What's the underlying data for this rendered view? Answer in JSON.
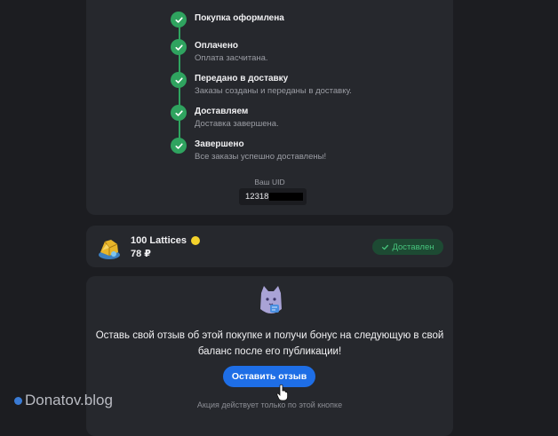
{
  "timeline": {
    "steps": [
      {
        "title": "Покупка оформлена",
        "desc": ""
      },
      {
        "title": "Оплачено",
        "desc": "Оплата засчитана."
      },
      {
        "title": "Передано в доставку",
        "desc": "Заказы созданы и переданы в доставку."
      },
      {
        "title": "Доставляем",
        "desc": "Доставка завершена."
      },
      {
        "title": "Завершено",
        "desc": "Все заказы успешно доставлены!"
      }
    ]
  },
  "uid": {
    "label": "Ваш UID",
    "value_visible": "12318"
  },
  "product": {
    "name": "100 Lattices",
    "price": "78 ₽",
    "status": "Доставлен"
  },
  "review": {
    "text": "Оставь свой отзыв об этой покупке и получи бонус на следующую в свой баланс после его публикации!",
    "button_label": "Оставить отзыв",
    "note": "Акция действует только по этой кнопке"
  },
  "watermark": {
    "text": "Donatov.blog"
  },
  "colors": {
    "background": "#1c1d21",
    "card": "#26282d",
    "success": "#2fa35f",
    "accent": "#1e6ee6",
    "coin": "#f4d22b"
  }
}
